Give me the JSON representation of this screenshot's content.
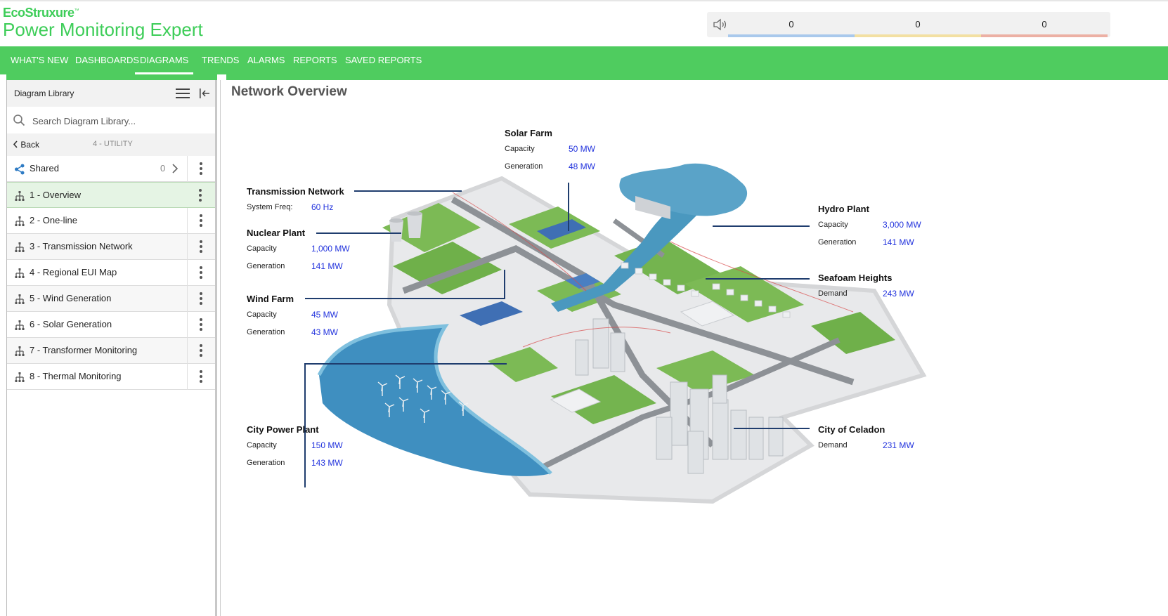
{
  "header": {
    "brand": "EcoStruxure",
    "brand_tm": "™",
    "product": "Power Monitoring Expert",
    "alarm_counts": [
      {
        "value": "0",
        "color": "#a9c9ec"
      },
      {
        "value": "0",
        "color": "#f3e0a2"
      },
      {
        "value": "0",
        "color": "#ecb0a4"
      }
    ]
  },
  "nav": {
    "items": [
      {
        "label": "WHAT'S NEW"
      },
      {
        "label": "DASHBOARDS"
      },
      {
        "label": "DIAGRAMS",
        "active": true
      },
      {
        "label": "TRENDS"
      },
      {
        "label": "ALARMS"
      },
      {
        "label": "REPORTS"
      },
      {
        "label": "SAVED REPORTS"
      }
    ]
  },
  "sidebar": {
    "title": "Diagram Library",
    "search_placeholder": "Search Diagram Library...",
    "back_label": "Back",
    "location": "4 - UTILITY",
    "shared_label": "Shared",
    "shared_count": "0",
    "items": [
      {
        "label": "1 - Overview",
        "selected": true
      },
      {
        "label": "2 - One-line"
      },
      {
        "label": "3 - Transmission Network"
      },
      {
        "label": "4 - Regional EUI Map"
      },
      {
        "label": "5 - Wind Generation"
      },
      {
        "label": "6 - Solar Generation"
      },
      {
        "label": "7 - Transformer Monitoring"
      },
      {
        "label": "8 - Thermal Monitoring"
      }
    ]
  },
  "main": {
    "title": "Network Overview",
    "labels": {
      "solar": {
        "name": "Solar Farm",
        "k1": "Capacity",
        "v1": "50 MW",
        "k2": "Generation",
        "v2": "48 MW"
      },
      "transmission": {
        "name": "Transmission Network",
        "k1": "System Freq:",
        "v1": "60 Hz"
      },
      "nuclear": {
        "name": "Nuclear Plant",
        "k1": "Capacity",
        "v1": "1,000 MW",
        "k2": "Generation",
        "v2": "141 MW"
      },
      "wind": {
        "name": "Wind Farm",
        "k1": "Capacity",
        "v1": "45 MW",
        "k2": "Generation",
        "v2": "43 MW"
      },
      "city_power": {
        "name": "City Power Plant",
        "k1": "Capacity",
        "v1": "150 MW",
        "k2": "Generation",
        "v2": "143 MW"
      },
      "hydro": {
        "name": "Hydro Plant",
        "k1": "Capacity",
        "v1": "3,000 MW",
        "k2": "Generation",
        "v2": "141 MW"
      },
      "seafoam": {
        "name": "Seafoam Heights",
        "k1": "Demand",
        "v1": "243 MW"
      },
      "celadon": {
        "name": "City of Celadon",
        "k1": "Demand",
        "v1": "231 MW"
      }
    }
  }
}
